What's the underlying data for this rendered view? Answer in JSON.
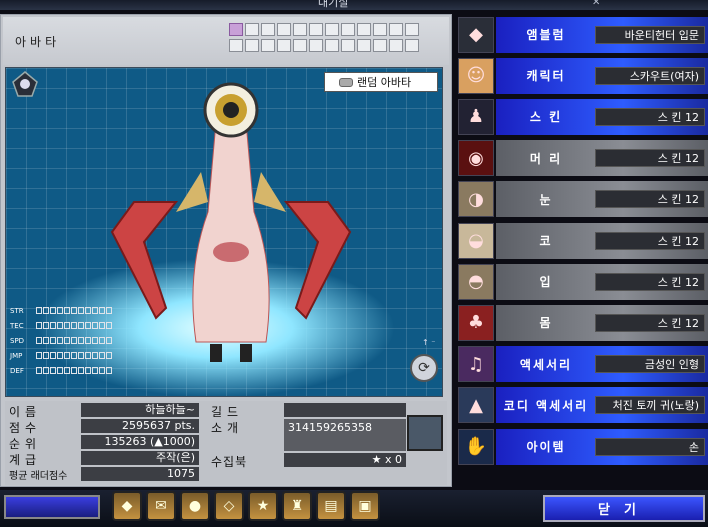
{
  "window": {
    "title": "대기실",
    "close": "✕"
  },
  "avatar": {
    "label": "아바타",
    "random_label": "랜덤 아바타",
    "stats": [
      "STR",
      "TEC",
      "SPD",
      "JMP",
      "DEF"
    ],
    "rotate_hint": "↑ ⁻",
    "slot_active_index": 0
  },
  "info": {
    "name_label": "이름",
    "name": "하늘하늘~",
    "score_label": "점수",
    "score": "2595637 pts.",
    "rank_label": "순위",
    "rank": "135263 (▲1000)",
    "grade_label": "계급",
    "grade": "주작(은)",
    "ladder_label": "평균 래더점수",
    "ladder": "1075",
    "guild_label": "길드",
    "guild": "",
    "intro_label": "소개",
    "intro": "314159265358",
    "collect_label": "수집북",
    "collect": "★ x 0"
  },
  "equipment": [
    {
      "category": "앰블럼",
      "value": "바운티헌터 입문",
      "style": "blue",
      "icon": "emblem-icon"
    },
    {
      "category": "캐릭터",
      "value": "스카우트(여자)",
      "style": "blue",
      "icon": "character-icon"
    },
    {
      "category": "스 킨",
      "value": "스 킨 12",
      "style": "blue",
      "icon": "skin-icon"
    },
    {
      "category": "머 리",
      "value": "스 킨 12",
      "style": "gray",
      "icon": "hair-icon"
    },
    {
      "category": "눈",
      "value": "스 킨 12",
      "style": "gray",
      "icon": "eye-icon"
    },
    {
      "category": "코",
      "value": "스 킨 12",
      "style": "gray",
      "icon": "nose-icon"
    },
    {
      "category": "입",
      "value": "스 킨 12",
      "style": "gray",
      "icon": "mouth-icon"
    },
    {
      "category": "몸",
      "value": "스 킨 12",
      "style": "gray",
      "icon": "body-icon"
    },
    {
      "category": "액세서리",
      "value": "금성인 인형",
      "style": "blue",
      "icon": "accessory-icon"
    },
    {
      "category": "코디 액세서리",
      "value": "처진 토끼 귀(노랑)",
      "style": "blue",
      "icon": "coordi-accessory-icon"
    },
    {
      "category": "아이템",
      "value": "손",
      "style": "blue",
      "icon": "item-hand-icon"
    }
  ],
  "toolbar": [
    "◆",
    "✉",
    "●",
    "◇",
    "★",
    "♜",
    "▤",
    "▣"
  ],
  "close_label": "닫기"
}
